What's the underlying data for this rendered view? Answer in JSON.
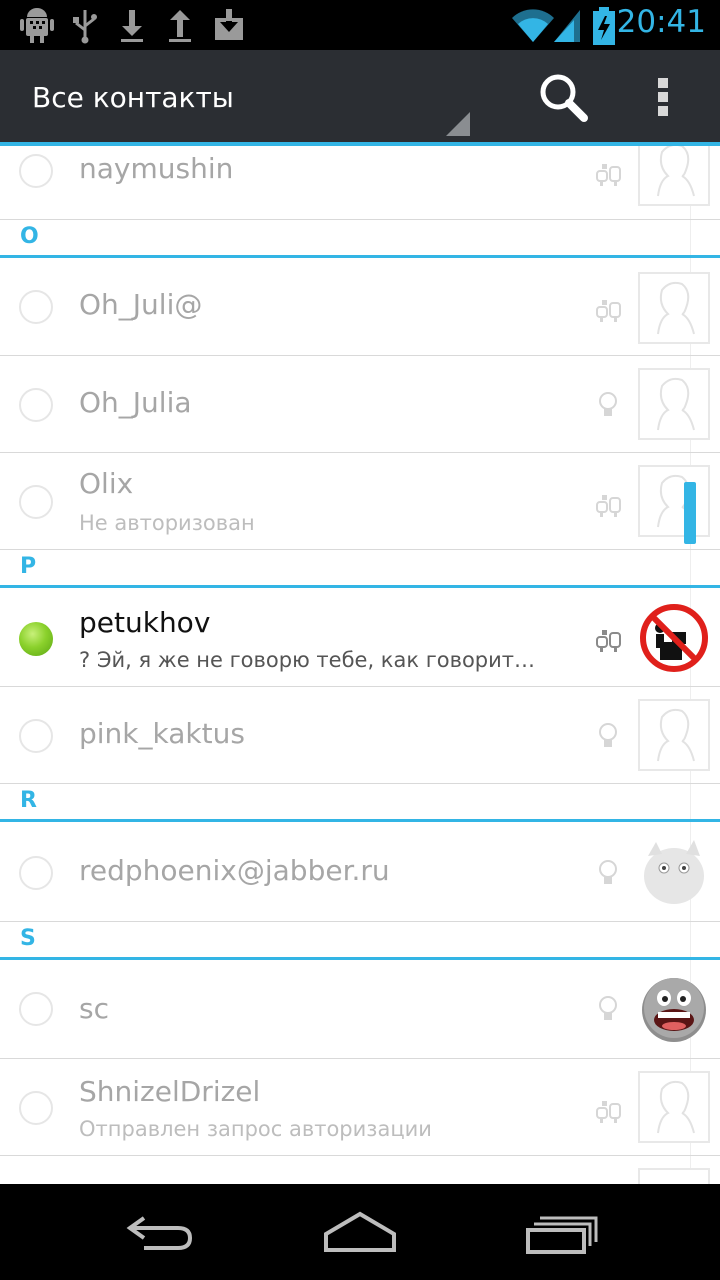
{
  "status_bar": {
    "time": "20:41",
    "icons": [
      "android-debug-icon",
      "usb-icon",
      "download-icon",
      "upload-icon",
      "download-box-icon",
      "wifi-icon",
      "signal-icon",
      "battery-charging-icon"
    ]
  },
  "action_bar": {
    "title": "Все контакты",
    "icons": [
      "search-icon",
      "overflow-menu-icon"
    ]
  },
  "accent_color": "#33b5e5",
  "contacts": [
    {
      "name": "naymushin",
      "status": "offline",
      "client_icon": "client-icon",
      "avatar": "placeholder-avatar"
    },
    {
      "section": "O"
    },
    {
      "name": "Oh_Juli@",
      "status": "offline",
      "client_icon": "client-icon",
      "avatar": "placeholder-avatar"
    },
    {
      "name": "Oh_Julia",
      "status": "offline",
      "client_icon": "bulb-icon",
      "avatar": "placeholder-avatar"
    },
    {
      "name": "Olix",
      "subtitle": "Не авторизован",
      "status": "offline",
      "client_icon": "client-icon",
      "avatar": "placeholder-avatar"
    },
    {
      "section": "P"
    },
    {
      "name": "petukhov",
      "subtitle": "? Эй, я же не говорю тебе, как говорит…",
      "status": "online",
      "client_icon": "client-icon",
      "avatar": "no-drinking-sign-avatar"
    },
    {
      "name": "pink_kaktus",
      "status": "offline",
      "client_icon": "bulb-icon",
      "avatar": "placeholder-avatar"
    },
    {
      "section": "R"
    },
    {
      "name": "redphoenix@jabber.ru",
      "status": "offline",
      "client_icon": "bulb-icon",
      "avatar": "furry-creature-avatar"
    },
    {
      "section": "S"
    },
    {
      "name": "sc",
      "status": "offline",
      "client_icon": "bulb-icon",
      "avatar": "smiley-avatar"
    },
    {
      "name": "ShnizelDrizel",
      "subtitle": "Отправлен запрос авторизации",
      "status": "offline",
      "client_icon": "client-icon",
      "avatar": "placeholder-avatar"
    }
  ],
  "nav_bar": {
    "icons": [
      "back-icon",
      "home-icon",
      "recent-apps-icon"
    ]
  }
}
